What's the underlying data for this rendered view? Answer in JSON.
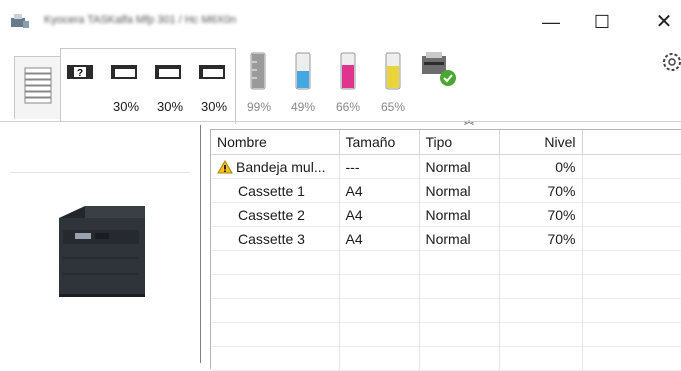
{
  "window": {
    "title": "Kyocera TASKalfa Mfp 301 / Hc M6X0n",
    "min_glyph": "—",
    "max_glyph": "☐",
    "close_glyph": "✕"
  },
  "toolbar": {
    "trays": [
      "30%",
      "30%",
      "30%"
    ],
    "toners": [
      {
        "label": "99%",
        "color": "#9a9a9a",
        "level": 0.99
      },
      {
        "label": "49%",
        "color": "#45a7e2",
        "level": 0.49
      },
      {
        "label": "66%",
        "color": "#e0358f",
        "level": 0.66
      },
      {
        "label": "65%",
        "color": "#e9d43c",
        "level": 0.65
      }
    ],
    "status_icon": "printer-ok-icon",
    "collapse_glyph": "︽",
    "settings_icon": "gear-icon"
  },
  "table": {
    "headers": [
      "Nombre",
      "Tamaño",
      "Tipo",
      "Nivel"
    ],
    "rows": [
      {
        "name": "Bandeja mul...",
        "size": "---",
        "type": "Normal",
        "level": "0%",
        "warning": true
      },
      {
        "name": "Cassette 1",
        "size": "A4",
        "type": "Normal",
        "level": "70%"
      },
      {
        "name": "Cassette 2",
        "size": "A4",
        "type": "Normal",
        "level": "70%"
      },
      {
        "name": "Cassette 3",
        "size": "A4",
        "type": "Normal",
        "level": "70%"
      }
    ]
  }
}
